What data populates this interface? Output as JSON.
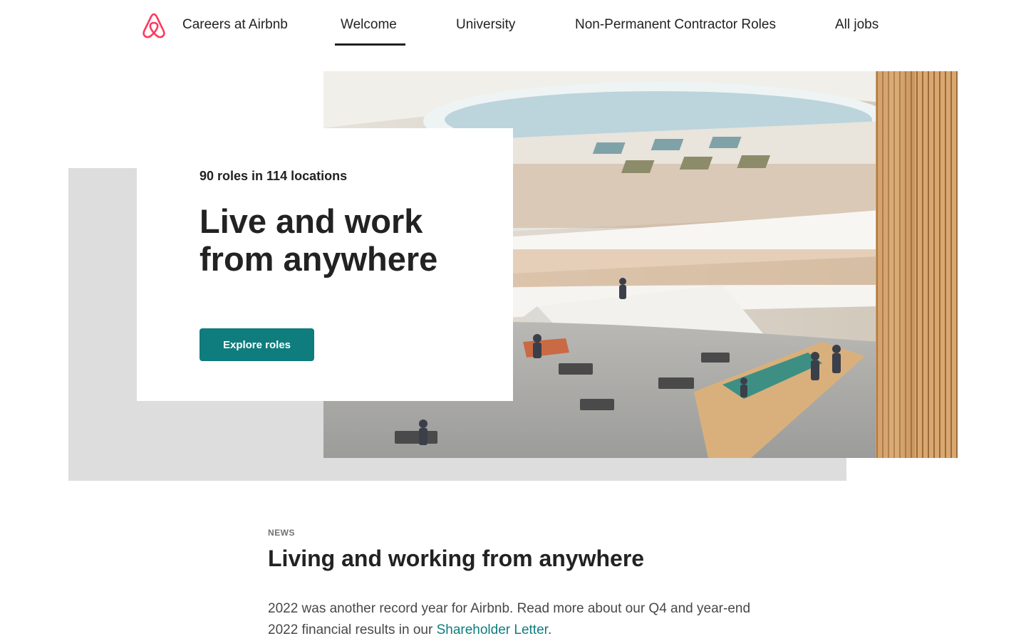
{
  "header": {
    "brand": "Careers at Airbnb",
    "nav": [
      {
        "label": "Welcome",
        "active": true
      },
      {
        "label": "University"
      },
      {
        "label": "Non-Permanent Contractor Roles"
      },
      {
        "label": "All jobs"
      }
    ],
    "accent_color": "#FF385C"
  },
  "hero": {
    "roles_count": "90 roles in 114 locations",
    "title_line1": "Live and work",
    "title_line2": "from anywhere",
    "cta_label": "Explore roles",
    "cta_color": "#0F7C7E"
  },
  "news": {
    "label": "NEWS",
    "title": "Living and working from anywhere",
    "body_before": "2022 was another record year for Airbnb. Read more about our Q4 and year-end 2022 financial results in our ",
    "link_text": "Shareholder Letter",
    "body_after": "."
  }
}
